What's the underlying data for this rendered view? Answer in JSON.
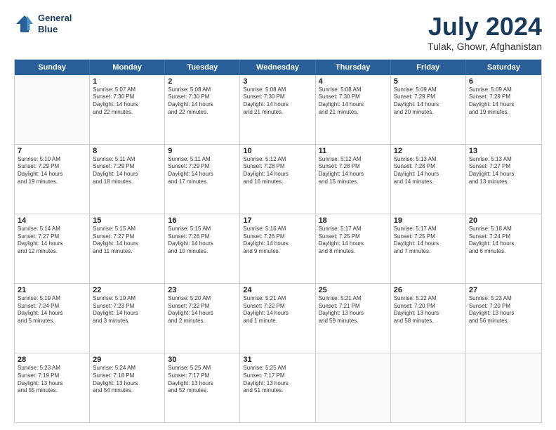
{
  "logo": {
    "line1": "General",
    "line2": "Blue"
  },
  "title": "July 2024",
  "subtitle": "Tulak, Ghowr, Afghanistan",
  "header_days": [
    "Sunday",
    "Monday",
    "Tuesday",
    "Wednesday",
    "Thursday",
    "Friday",
    "Saturday"
  ],
  "weeks": [
    [
      {
        "day": "",
        "info": ""
      },
      {
        "day": "1",
        "info": "Sunrise: 5:07 AM\nSunset: 7:30 PM\nDaylight: 14 hours\nand 22 minutes."
      },
      {
        "day": "2",
        "info": "Sunrise: 5:08 AM\nSunset: 7:30 PM\nDaylight: 14 hours\nand 22 minutes."
      },
      {
        "day": "3",
        "info": "Sunrise: 5:08 AM\nSunset: 7:30 PM\nDaylight: 14 hours\nand 21 minutes."
      },
      {
        "day": "4",
        "info": "Sunrise: 5:08 AM\nSunset: 7:30 PM\nDaylight: 14 hours\nand 21 minutes."
      },
      {
        "day": "5",
        "info": "Sunrise: 5:09 AM\nSunset: 7:29 PM\nDaylight: 14 hours\nand 20 minutes."
      },
      {
        "day": "6",
        "info": "Sunrise: 5:09 AM\nSunset: 7:29 PM\nDaylight: 14 hours\nand 19 minutes."
      }
    ],
    [
      {
        "day": "7",
        "info": "Sunrise: 5:10 AM\nSunset: 7:29 PM\nDaylight: 14 hours\nand 19 minutes."
      },
      {
        "day": "8",
        "info": "Sunrise: 5:11 AM\nSunset: 7:29 PM\nDaylight: 14 hours\nand 18 minutes."
      },
      {
        "day": "9",
        "info": "Sunrise: 5:11 AM\nSunset: 7:29 PM\nDaylight: 14 hours\nand 17 minutes."
      },
      {
        "day": "10",
        "info": "Sunrise: 5:12 AM\nSunset: 7:28 PM\nDaylight: 14 hours\nand 16 minutes."
      },
      {
        "day": "11",
        "info": "Sunrise: 5:12 AM\nSunset: 7:28 PM\nDaylight: 14 hours\nand 15 minutes."
      },
      {
        "day": "12",
        "info": "Sunrise: 5:13 AM\nSunset: 7:28 PM\nDaylight: 14 hours\nand 14 minutes."
      },
      {
        "day": "13",
        "info": "Sunrise: 5:13 AM\nSunset: 7:27 PM\nDaylight: 14 hours\nand 13 minutes."
      }
    ],
    [
      {
        "day": "14",
        "info": "Sunrise: 5:14 AM\nSunset: 7:27 PM\nDaylight: 14 hours\nand 12 minutes."
      },
      {
        "day": "15",
        "info": "Sunrise: 5:15 AM\nSunset: 7:27 PM\nDaylight: 14 hours\nand 11 minutes."
      },
      {
        "day": "16",
        "info": "Sunrise: 5:15 AM\nSunset: 7:26 PM\nDaylight: 14 hours\nand 10 minutes."
      },
      {
        "day": "17",
        "info": "Sunrise: 5:16 AM\nSunset: 7:26 PM\nDaylight: 14 hours\nand 9 minutes."
      },
      {
        "day": "18",
        "info": "Sunrise: 5:17 AM\nSunset: 7:25 PM\nDaylight: 14 hours\nand 8 minutes."
      },
      {
        "day": "19",
        "info": "Sunrise: 5:17 AM\nSunset: 7:25 PM\nDaylight: 14 hours\nand 7 minutes."
      },
      {
        "day": "20",
        "info": "Sunrise: 5:18 AM\nSunset: 7:24 PM\nDaylight: 14 hours\nand 6 minutes."
      }
    ],
    [
      {
        "day": "21",
        "info": "Sunrise: 5:19 AM\nSunset: 7:24 PM\nDaylight: 14 hours\nand 5 minutes."
      },
      {
        "day": "22",
        "info": "Sunrise: 5:19 AM\nSunset: 7:23 PM\nDaylight: 14 hours\nand 3 minutes."
      },
      {
        "day": "23",
        "info": "Sunrise: 5:20 AM\nSunset: 7:22 PM\nDaylight: 14 hours\nand 2 minutes."
      },
      {
        "day": "24",
        "info": "Sunrise: 5:21 AM\nSunset: 7:22 PM\nDaylight: 14 hours\nand 1 minute."
      },
      {
        "day": "25",
        "info": "Sunrise: 5:21 AM\nSunset: 7:21 PM\nDaylight: 13 hours\nand 59 minutes."
      },
      {
        "day": "26",
        "info": "Sunrise: 5:22 AM\nSunset: 7:20 PM\nDaylight: 13 hours\nand 58 minutes."
      },
      {
        "day": "27",
        "info": "Sunrise: 5:23 AM\nSunset: 7:20 PM\nDaylight: 13 hours\nand 56 minutes."
      }
    ],
    [
      {
        "day": "28",
        "info": "Sunrise: 5:23 AM\nSunset: 7:19 PM\nDaylight: 13 hours\nand 55 minutes."
      },
      {
        "day": "29",
        "info": "Sunrise: 5:24 AM\nSunset: 7:18 PM\nDaylight: 13 hours\nand 54 minutes."
      },
      {
        "day": "30",
        "info": "Sunrise: 5:25 AM\nSunset: 7:17 PM\nDaylight: 13 hours\nand 52 minutes."
      },
      {
        "day": "31",
        "info": "Sunrise: 5:25 AM\nSunset: 7:17 PM\nDaylight: 13 hours\nand 51 minutes."
      },
      {
        "day": "",
        "info": ""
      },
      {
        "day": "",
        "info": ""
      },
      {
        "day": "",
        "info": ""
      }
    ]
  ]
}
